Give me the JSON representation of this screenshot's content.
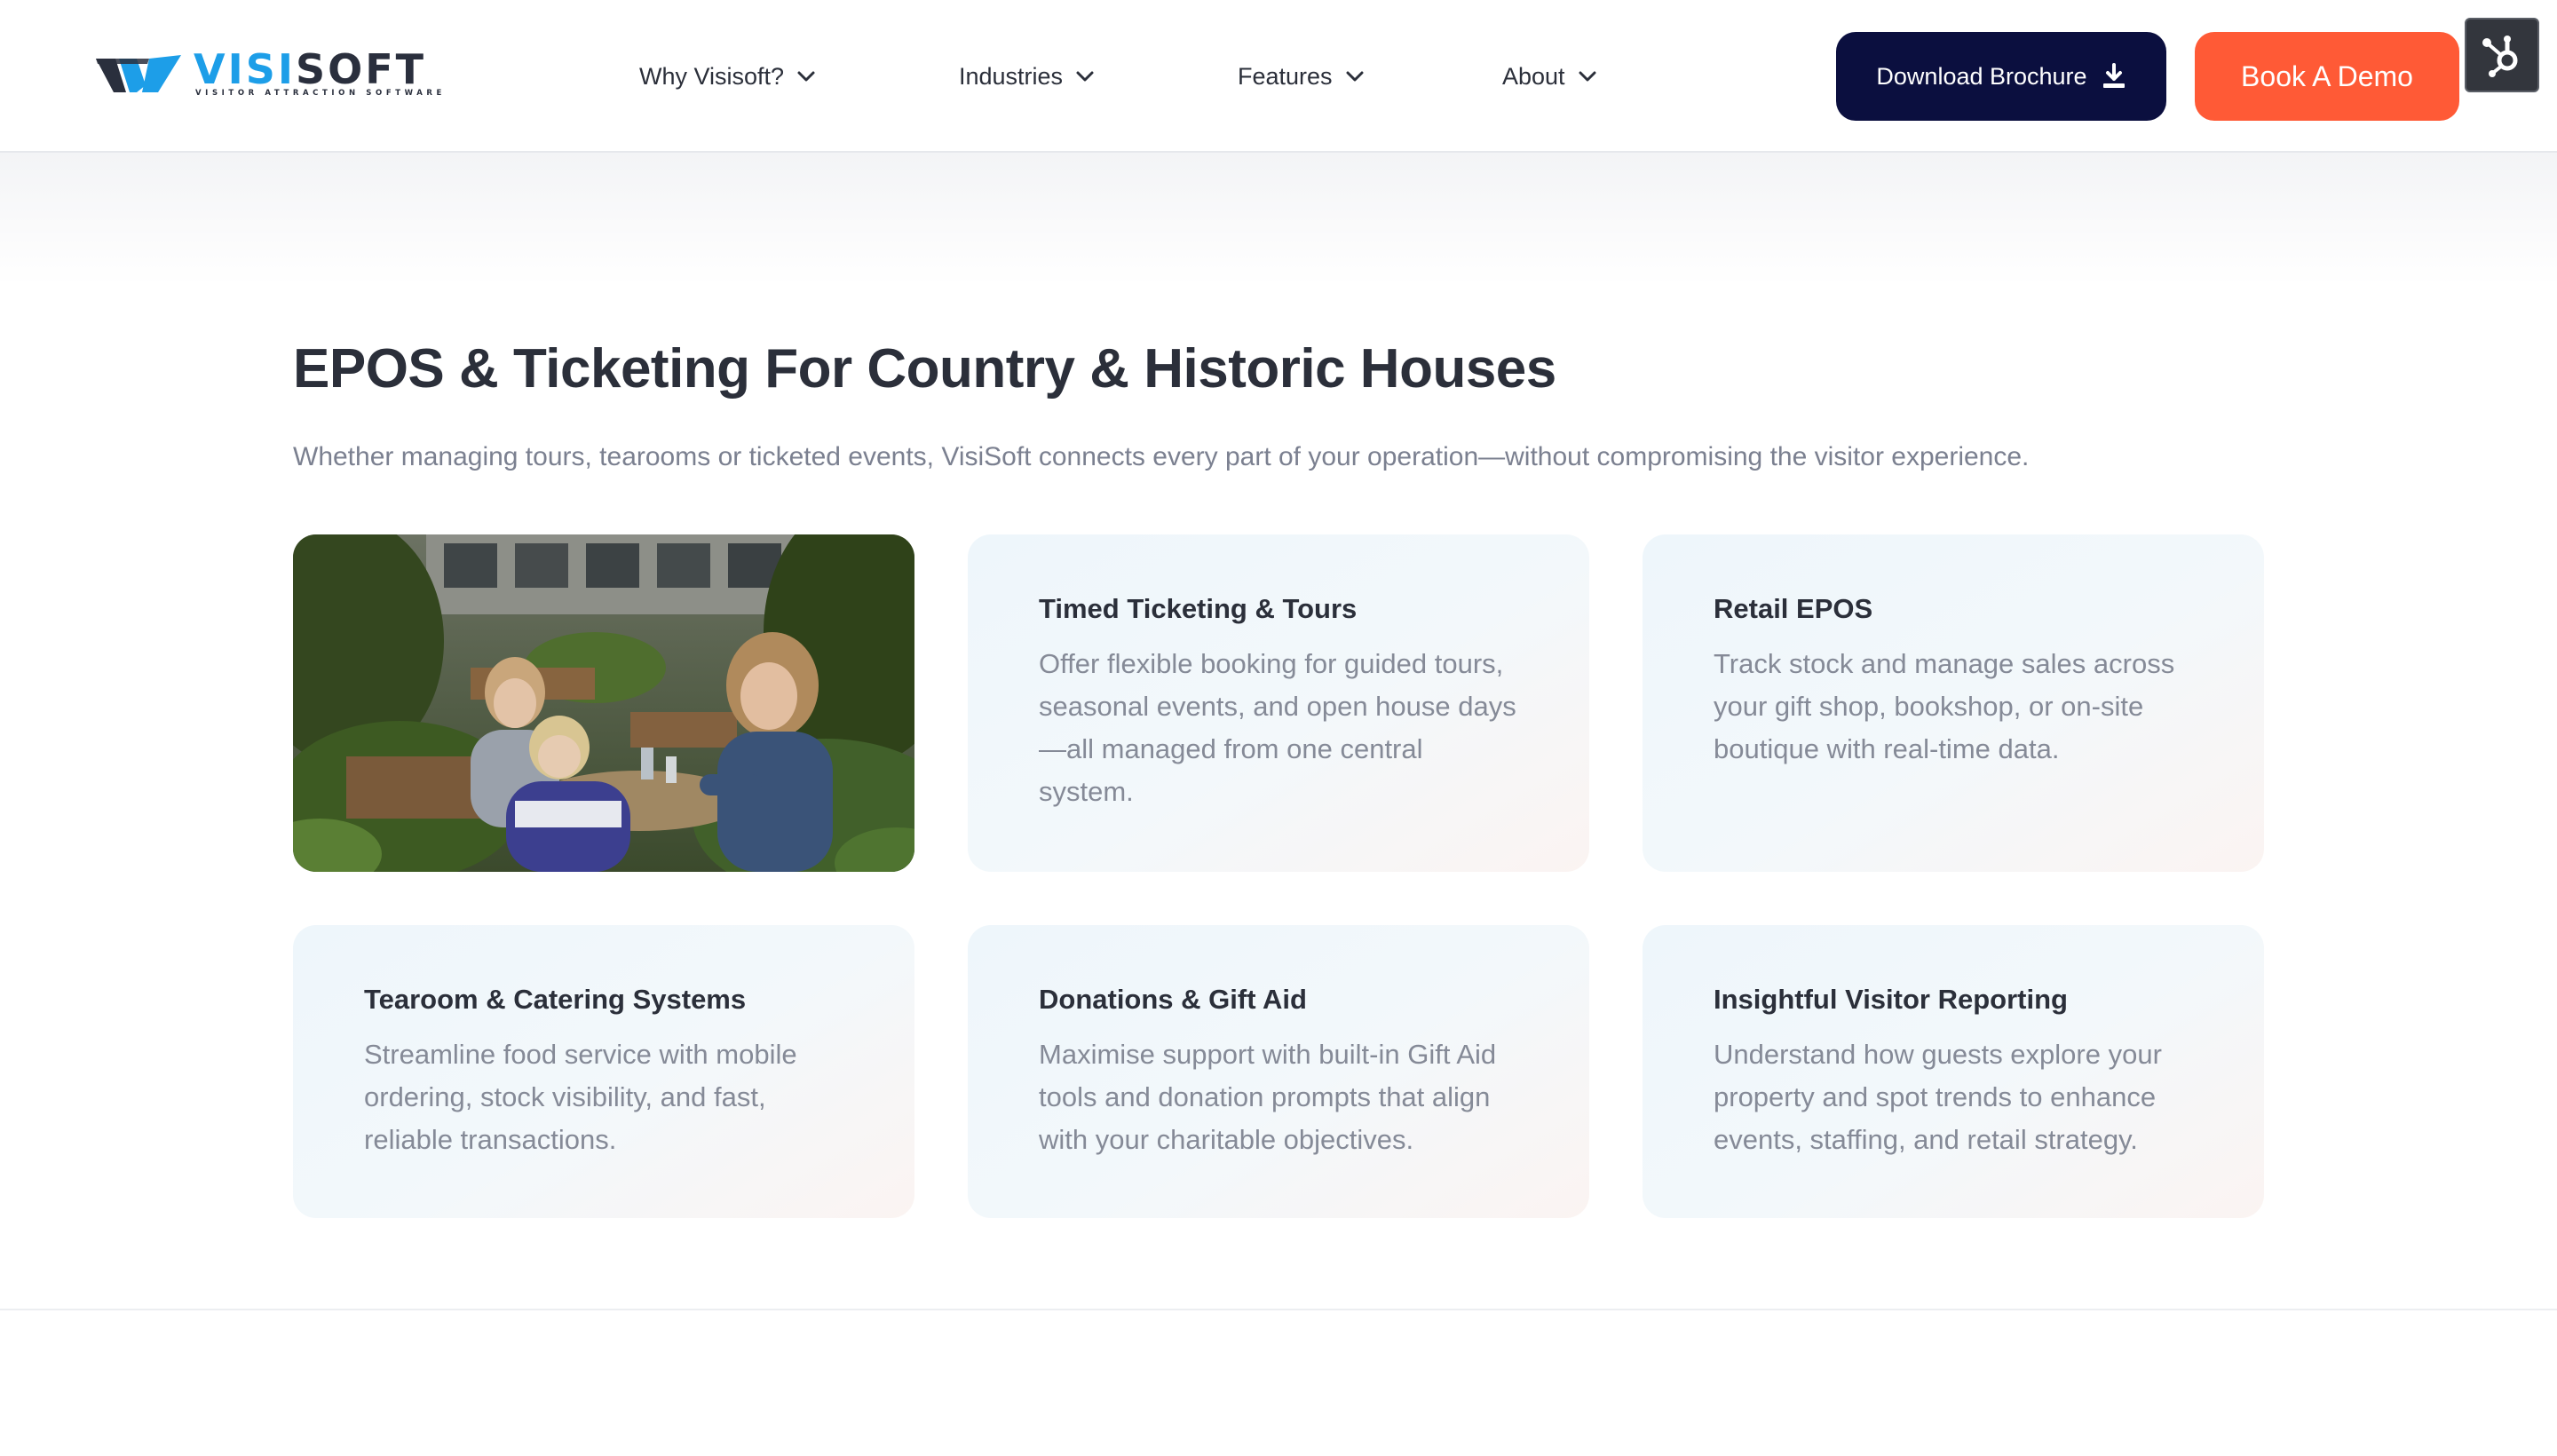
{
  "brand": {
    "name_part1": "VISI",
    "name_part2": "SOFT",
    "tagline": "VISITOR ATTRACTION SOFTWARE",
    "primary_color": "#1d9ee8",
    "dark_color": "#2a2f3d"
  },
  "nav": {
    "items": [
      {
        "label": "Why Visisoft?",
        "icon": "chevron-down-icon"
      },
      {
        "label": "Industries",
        "icon": "chevron-down-icon"
      },
      {
        "label": "Features",
        "icon": "chevron-down-icon"
      },
      {
        "label": "About",
        "icon": "chevron-down-icon"
      }
    ],
    "brochure_label": "Download Brochure",
    "brochure_icon": "download-icon",
    "brochure_color": "#0b0f3f",
    "demo_label": "Book A Demo",
    "demo_color": "#ff5a36",
    "hubspot_icon": "hubspot-sprocket-icon"
  },
  "section": {
    "title": "EPOS & Ticketing For Country & Historic Houses",
    "subtitle": "Whether managing tours, tearooms or ticketed events, VisiSoft connects every part of your operation—without compromising the visitor experience.",
    "cards": [
      {
        "title": "Timed Ticketing & Tours",
        "text": "Offer flexible booking for guided tours, seasonal events, and open house days—all managed from one central system."
      },
      {
        "title": "Retail EPOS",
        "text": "Track stock and manage sales across your gift shop, bookshop, or on-site boutique with real-time data."
      },
      {
        "title": "Tearoom & Catering Systems",
        "text": "Streamline food service with mobile ordering, stock visibility, and fast, reliable transactions."
      },
      {
        "title": "Donations & Gift Aid",
        "text": "Maximise support with built-in Gift Aid tools and donation prompts that align with your charitable objectives."
      },
      {
        "title": "Insightful Visitor Reporting",
        "text": "Understand how guests explore your property and spot trends to enhance events, staffing, and retail strategy."
      }
    ]
  }
}
